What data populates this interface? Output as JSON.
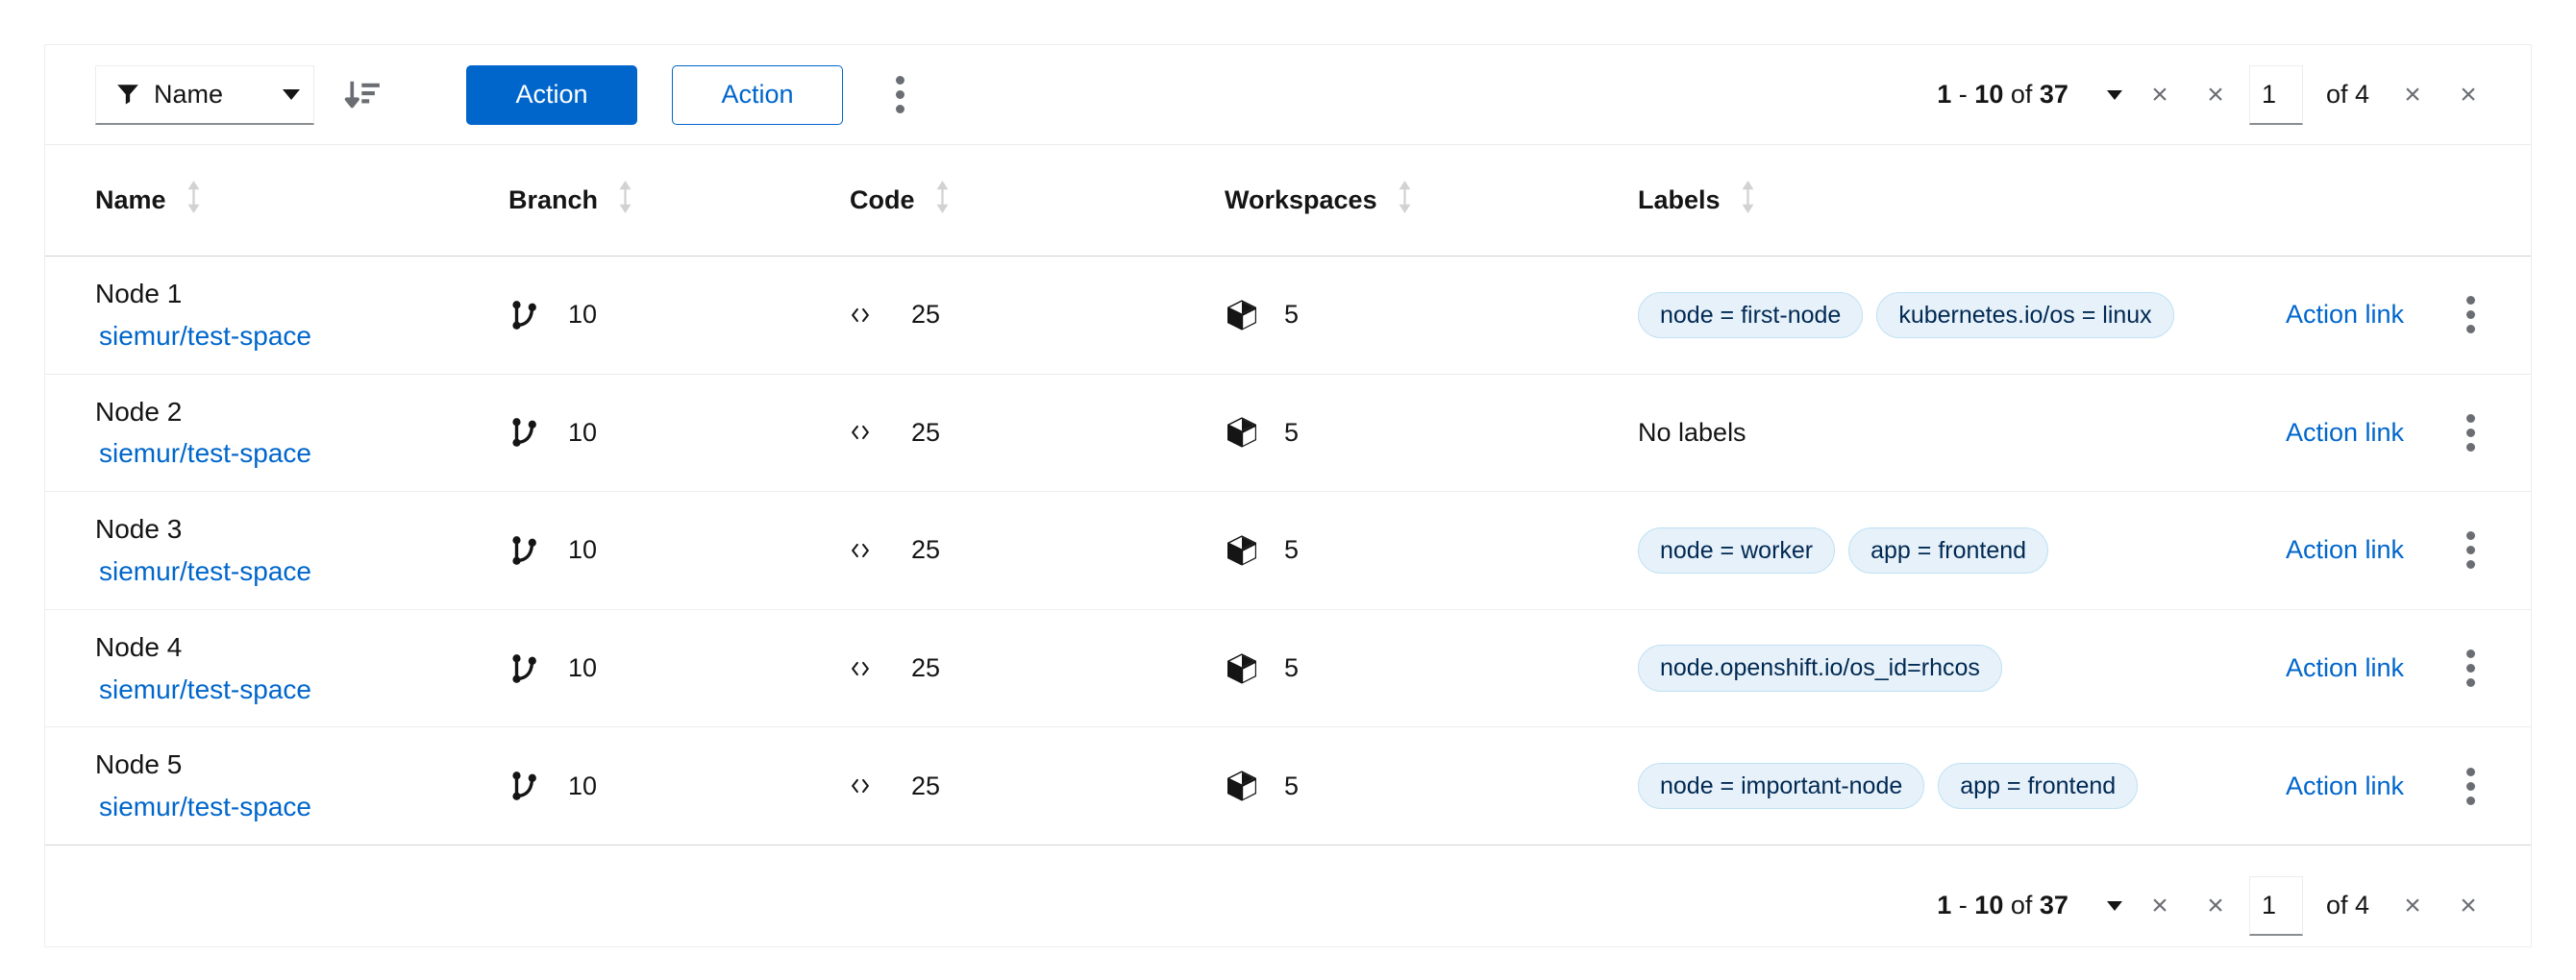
{
  "toolbar": {
    "filter": {
      "icon": "filter-icon",
      "label": "Name",
      "caret_icon": "caret-down-icon"
    },
    "sort_icon": "sort-amount-down-icon",
    "primary_button": "Action",
    "secondary_button": "Action",
    "kebab_icon": "kebab-vertical-icon"
  },
  "pagination": {
    "range_start": "1",
    "range_separator": " - ",
    "range_end": "10",
    "of_word": "of",
    "total": "37",
    "summary": "1 - 10 of 37",
    "options_caret_icon": "caret-down-icon",
    "first_page_icon": "angle-double-left-icon",
    "prev_page_icon": "angle-left-icon",
    "page_value": "1",
    "page_of": "of 4",
    "total_pages": "4",
    "next_page_icon": "angle-right-icon",
    "last_page_icon": "angle-double-right-icon",
    "nav_glyph": "×"
  },
  "table": {
    "columns": [
      {
        "label": "Name",
        "sort_icon": "sort-both-icon"
      },
      {
        "label": "Branch",
        "sort_icon": "sort-both-icon"
      },
      {
        "label": "Code",
        "sort_icon": "sort-both-icon"
      },
      {
        "label": "Workspaces",
        "sort_icon": "sort-both-icon"
      },
      {
        "label": "Labels",
        "sort_icon": "sort-both-icon"
      }
    ],
    "row_action_label": "Action link",
    "row_kebab_icon": "kebab-vertical-icon",
    "branch_icon": "code-branch-icon",
    "code_icon": "code-icon",
    "workspaces_icon": "cube-icon",
    "no_labels_text": "No labels",
    "rows": [
      {
        "name": "Node 1",
        "link": "siemur/test-space",
        "branch": "10",
        "code": "25",
        "workspaces": "5",
        "labels": [
          "node = first-node",
          "kubernetes.io/os = linux"
        ],
        "action": "Action link"
      },
      {
        "name": "Node 2",
        "link": "siemur/test-space",
        "branch": "10",
        "code": "25",
        "workspaces": "5",
        "labels": [],
        "action": "Action link"
      },
      {
        "name": "Node 3",
        "link": "siemur/test-space",
        "branch": "10",
        "code": "25",
        "workspaces": "5",
        "labels": [
          "node = worker",
          "app = frontend"
        ],
        "action": "Action link"
      },
      {
        "name": "Node 4",
        "link": "siemur/test-space",
        "branch": "10",
        "code": "25",
        "workspaces": "5",
        "labels": [
          "node.openshift.io/os_id=rhcos"
        ],
        "action": "Action link"
      },
      {
        "name": "Node 5",
        "link": "siemur/test-space",
        "branch": "10",
        "code": "25",
        "workspaces": "5",
        "labels": [
          "node = important-node",
          "app = frontend"
        ],
        "action": "Action link"
      }
    ]
  },
  "colors": {
    "primary": "#0066cc",
    "link": "#0066cc",
    "chip_bg": "#e7f1fa",
    "chip_border": "#bee1f4",
    "chip_text": "#002952",
    "border": "#ededed",
    "text": "#151515",
    "muted": "#6a6e73"
  }
}
